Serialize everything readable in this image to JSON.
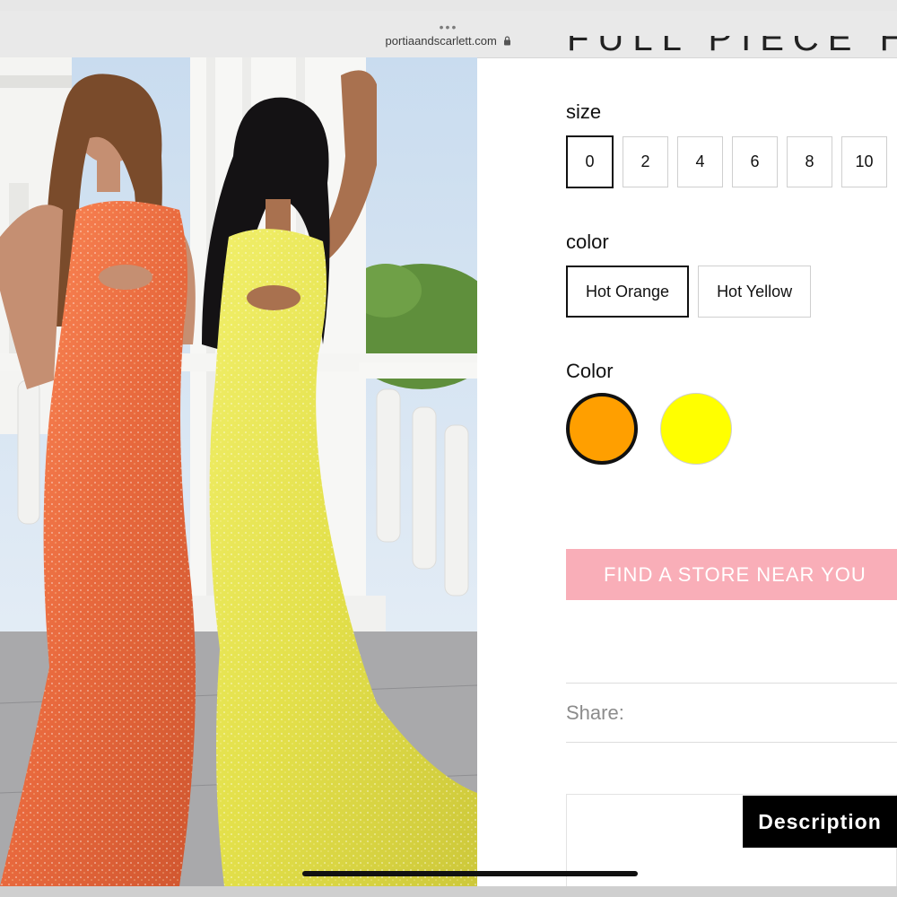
{
  "browser": {
    "menu_dots": "•••",
    "url": "portiaandscarlett.com",
    "lock_icon": "lock-icon"
  },
  "product": {
    "title_fragment": "FULL PIECE HOT CL",
    "image_icon": "product-photo"
  },
  "options": {
    "size_label": "size",
    "sizes": [
      "0",
      "2",
      "4",
      "6",
      "8",
      "10"
    ],
    "selected_size": "0",
    "color_label": "color",
    "colors": [
      "Hot Orange",
      "Hot Yellow"
    ],
    "selected_color": "Hot Orange",
    "color_swatch_label": "Color",
    "swatches": [
      {
        "name": "Hot Orange",
        "hex": "#ff9f00"
      },
      {
        "name": "Hot Yellow",
        "hex": "#ffff00"
      }
    ]
  },
  "actions": {
    "find_store_label": "FIND A STORE NEAR YOU",
    "find_store_color": "#f9aeb8",
    "share_label": "Share:"
  },
  "tabs": {
    "description_label": "Description"
  }
}
